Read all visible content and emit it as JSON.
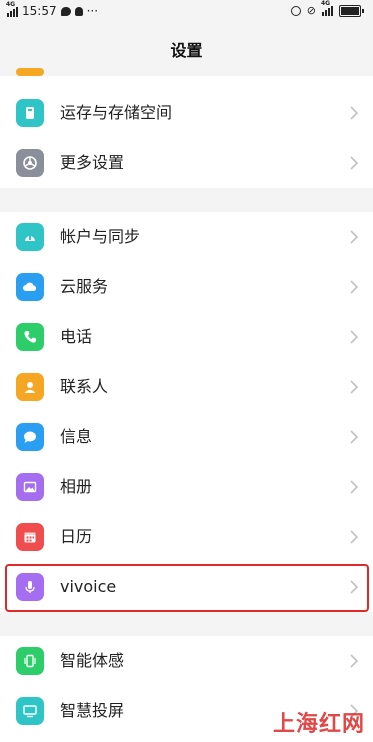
{
  "status_bar": {
    "network": "4G",
    "time": "15:57",
    "dots": "···",
    "network_right": "4G"
  },
  "header": {
    "title": "设置"
  },
  "groups": [
    {
      "items": [
        {
          "label": "运存与存储空间",
          "icon": "storage-icon",
          "color": "#2fc4c6"
        },
        {
          "label": "更多设置",
          "icon": "settings-gear-icon",
          "color": "#8a8f99"
        }
      ]
    },
    {
      "items": [
        {
          "label": "帐户与同步",
          "icon": "account-sync-icon",
          "color": "#2fc4c6"
        },
        {
          "label": "云服务",
          "icon": "cloud-icon",
          "color": "#2a9ff2"
        },
        {
          "label": "电话",
          "icon": "phone-icon",
          "color": "#2dce6a"
        },
        {
          "label": "联系人",
          "icon": "contacts-icon",
          "color": "#f5a623"
        },
        {
          "label": "信息",
          "icon": "message-icon",
          "color": "#2a9ff2"
        },
        {
          "label": "相册",
          "icon": "album-icon",
          "color": "#a56ef0"
        },
        {
          "label": "日历",
          "icon": "calendar-icon",
          "color": "#f04e4e"
        },
        {
          "label": "vivoice",
          "icon": "microphone-icon",
          "color": "#a56ef0"
        }
      ]
    },
    {
      "items": [
        {
          "label": "智能体感",
          "icon": "smart-motion-icon",
          "color": "#2dce6a"
        },
        {
          "label": "智慧投屏",
          "icon": "screen-cast-icon",
          "color": "#2fc4c6"
        }
      ]
    }
  ],
  "watermark": "上海红网"
}
